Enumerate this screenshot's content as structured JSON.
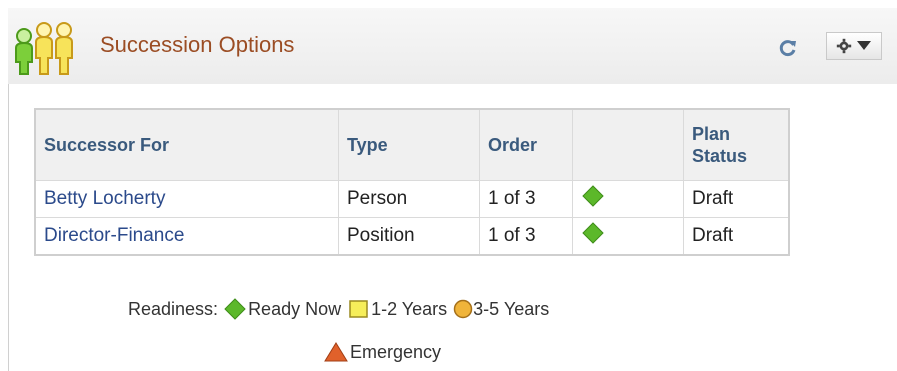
{
  "header": {
    "title": "Succession Options",
    "icon": "people-group-icon",
    "refresh_icon": "refresh-icon",
    "actions_icon": "gear-dropdown-icon"
  },
  "table": {
    "columns": [
      "Successor For",
      "Type",
      "Order",
      "",
      "Plan Status"
    ],
    "plan_status_header_line1": "Plan",
    "plan_status_header_line2": "Status",
    "rows": [
      {
        "successor_for": "Betty Locherty",
        "type": "Person",
        "order": "1 of 3",
        "readiness": "Ready Now",
        "plan_status": "Draft"
      },
      {
        "successor_for": "Director-Finance",
        "type": "Position",
        "order": "1 of 3",
        "readiness": "Ready Now",
        "plan_status": "Draft"
      }
    ]
  },
  "legend": {
    "label": "Readiness:",
    "items": [
      {
        "symbol": "green-diamond-icon",
        "text": "Ready Now"
      },
      {
        "symbol": "yellow-square-icon",
        "text": "1-2 Years"
      },
      {
        "symbol": "orange-circle-icon",
        "text": "3-5 Years"
      },
      {
        "symbol": "red-triangle-icon",
        "text": "Emergency"
      }
    ]
  },
  "colors": {
    "title": "#9b4d24",
    "link": "#2b4a8b",
    "header_text": "#3a5a7d",
    "ready_now": "#5cb82a",
    "years_1_2": "#f6ee5a",
    "years_3_5": "#f0b43a",
    "emergency": "#e0612b"
  }
}
